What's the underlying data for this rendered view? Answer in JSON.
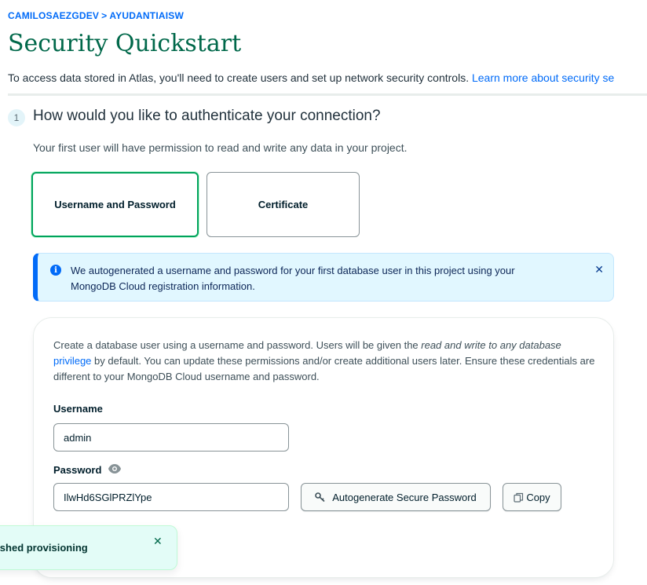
{
  "breadcrumb": {
    "org": "CAMILOSAEZGDEV",
    "separator": ">",
    "project": "AYUDANTIAISW"
  },
  "page_title": "Security Quickstart",
  "intro": {
    "text": "To access data stored in Atlas, you'll need to create users and set up network security controls. ",
    "link": "Learn more about security se"
  },
  "step": {
    "number": "1",
    "title": "How would you like to authenticate your connection?",
    "description": "Your first user will have permission to read and write any data in your project."
  },
  "auth_options": {
    "username_password": "Username and Password",
    "certificate": "Certificate",
    "selected": "username_password"
  },
  "info_banner": {
    "text": "We autogenerated a username and password for your first database user in this project using your MongoDB Cloud registration information.",
    "close": "✕"
  },
  "form": {
    "desc_part1": "Create a database user using a username and password. Users will be given the ",
    "desc_italic": "read and write to any database",
    "desc_link": "privilege",
    "desc_part2": " by default. You can update these permissions and/or create additional users later. Ensure these credentials are different to your MongoDB Cloud username and password.",
    "username_label": "Username",
    "username_value": "admin",
    "password_label": "Password",
    "password_value": "IlwHd6SGlPRZlYpe",
    "autogenerate_label": "Autogenerate Secure Password",
    "copy_label": "Copy"
  },
  "toast": {
    "text": "inished provisioning.",
    "close": "✕"
  },
  "colors": {
    "accent_green": "#00684a",
    "link_blue": "#016bf8",
    "banner_bg": "#e1f7ff",
    "toast_bg": "#e3fcf7"
  }
}
